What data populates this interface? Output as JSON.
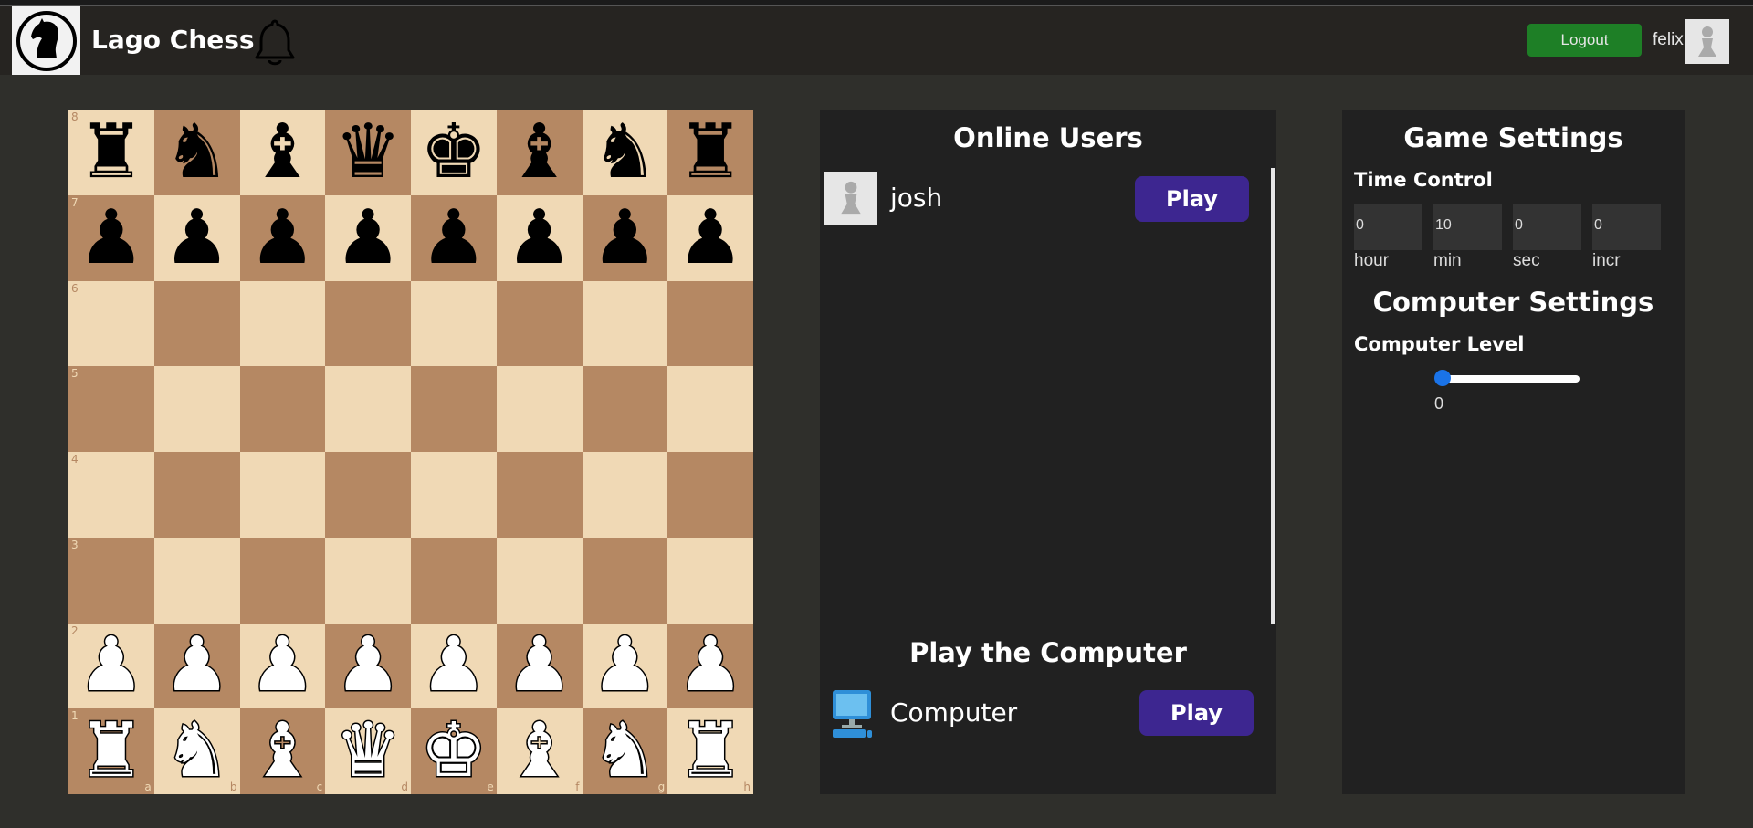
{
  "app": {
    "title": "Lago Chess"
  },
  "header": {
    "logout_label": "Logout",
    "username": "felix"
  },
  "board": {
    "ranks": [
      "8",
      "7",
      "6",
      "5",
      "4",
      "3",
      "2",
      "1"
    ],
    "files": [
      "a",
      "b",
      "c",
      "d",
      "e",
      "f",
      "g",
      "h"
    ],
    "pieces": {
      "8": [
        "♜",
        "♞",
        "♝",
        "♛",
        "♚",
        "♝",
        "♞",
        "♜"
      ],
      "7": [
        "♟",
        "♟",
        "♟",
        "♟",
        "♟",
        "♟",
        "♟",
        "♟"
      ],
      "2": [
        "♟",
        "♟",
        "♟",
        "♟",
        "♟",
        "♟",
        "♟",
        "♟"
      ],
      "1": [
        "♜",
        "♞",
        "♝",
        "♛",
        "♚",
        "♝",
        "♞",
        "♜"
      ]
    },
    "colors": {
      "light": "#f0d9b5",
      "dark": "#b58863"
    }
  },
  "online_users": {
    "title": "Online Users",
    "users": [
      {
        "name": "josh",
        "play_label": "Play"
      }
    ]
  },
  "play_computer": {
    "title": "Play the Computer",
    "name": "Computer",
    "play_label": "Play"
  },
  "game_settings": {
    "title": "Game Settings",
    "time_control_label": "Time Control",
    "time_fields": [
      {
        "value": "0",
        "label": "hour"
      },
      {
        "value": "10",
        "label": "min"
      },
      {
        "value": "0",
        "label": "sec"
      },
      {
        "value": "0",
        "label": "incr"
      }
    ]
  },
  "computer_settings": {
    "title": "Computer Settings",
    "level_label": "Computer Level",
    "level_value": "0"
  },
  "icons": {
    "logo": "knight-logo-icon",
    "bell": "bell-icon",
    "avatar": "pawn-avatar-icon",
    "computer": "computer-icon"
  },
  "accent_colors": {
    "logout": "#1e7f26",
    "play": "#3d2690",
    "slider": "#1a73e8"
  }
}
